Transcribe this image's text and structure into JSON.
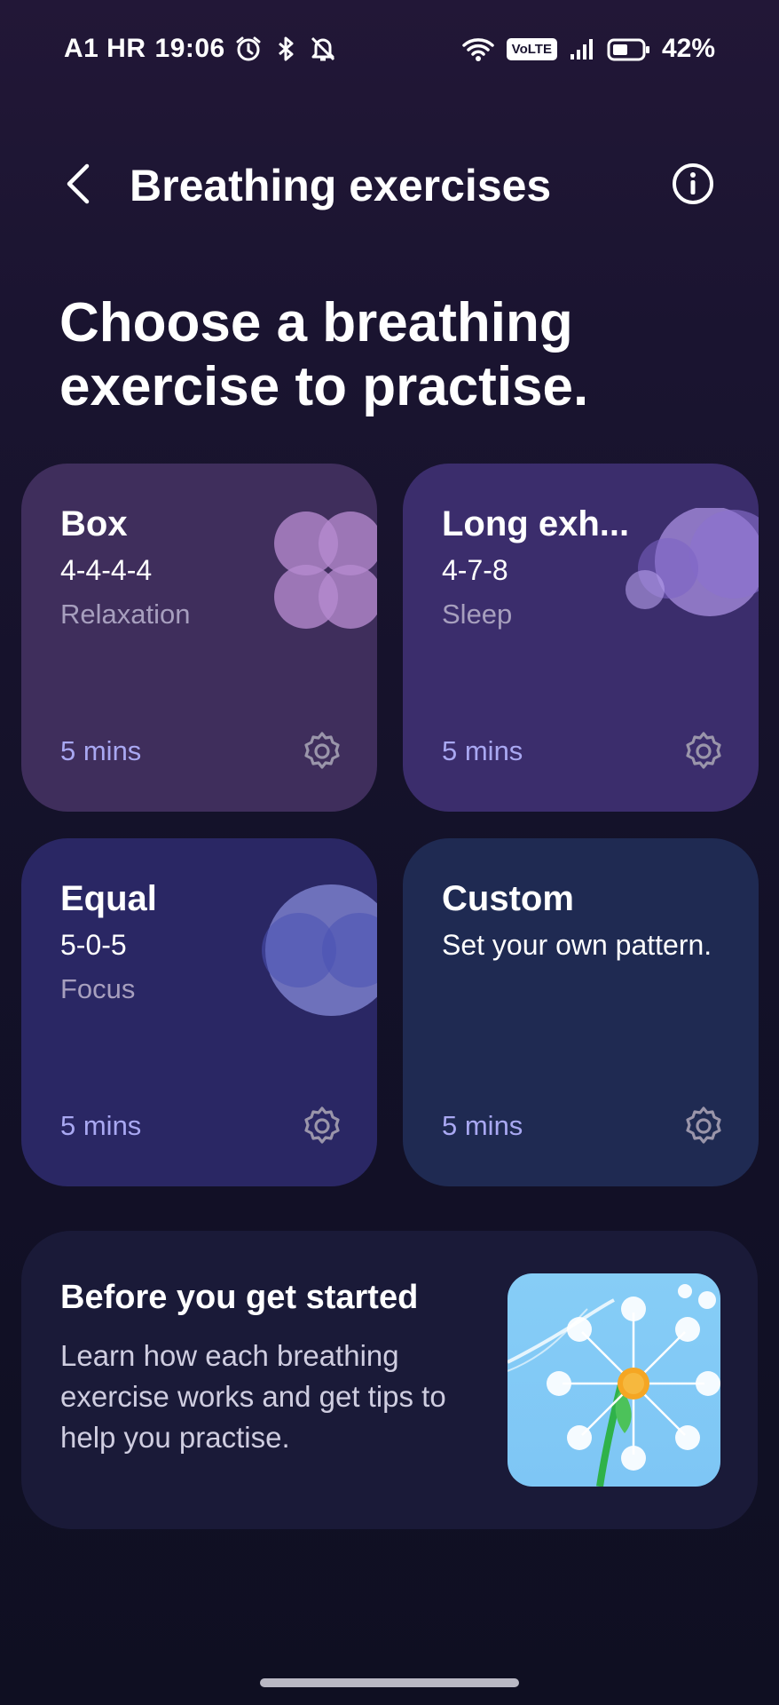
{
  "status_bar": {
    "carrier": "A1 HR",
    "time": "19:06",
    "network": "VoLTE",
    "battery": "42%",
    "icons": [
      "alarm-icon",
      "bluetooth-icon",
      "silent-bell-icon",
      "wifi-icon",
      "signal-icon",
      "battery-icon"
    ]
  },
  "header": {
    "title": "Breathing exercises",
    "back_icon": "back-arrow-icon",
    "info_icon": "info-icon"
  },
  "heading": "Choose a breathing exercise to practise.",
  "exercises": [
    {
      "title": "Box",
      "pattern": "4-4-4-4",
      "type": "Relaxation",
      "duration": "5 mins",
      "color": "#3f2e5c"
    },
    {
      "title": "Long exh...",
      "pattern": "4-7-8",
      "type": "Sleep",
      "duration": "5 mins",
      "color": "#3b2d6c"
    },
    {
      "title": "Equal",
      "pattern": "5-0-5",
      "type": "Focus",
      "duration": "5 mins",
      "color": "#2a2764"
    },
    {
      "title": "Custom",
      "pattern": "Set your own pattern.",
      "type": "",
      "duration": "5 mins",
      "color": "#1f2a52"
    }
  ],
  "info_card": {
    "title": "Before you get started",
    "body": "Learn how each breathing exercise works and get tips to help you practise.",
    "image": "dandelion-illustration"
  },
  "colors": {
    "accent_duration": "#a9a8f2",
    "background": "#1a1430"
  }
}
